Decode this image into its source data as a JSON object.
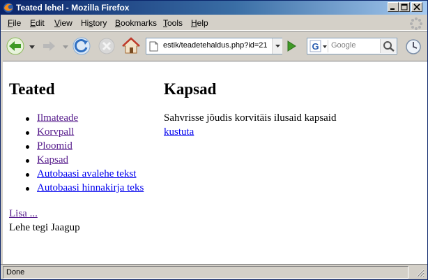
{
  "window": {
    "title": "Teated lehel - Mozilla Firefox"
  },
  "menu": [
    {
      "label": "File",
      "accel": "F"
    },
    {
      "label": "Edit",
      "accel": "E"
    },
    {
      "label": "View",
      "accel": "V"
    },
    {
      "label": "History",
      "accel": "s"
    },
    {
      "label": "Bookmarks",
      "accel": "B"
    },
    {
      "label": "Tools",
      "accel": "T"
    },
    {
      "label": "Help",
      "accel": "H"
    }
  ],
  "toolbar": {
    "url": "estik/teadetehaldus.php?id=21",
    "search_placeholder": "Google",
    "icons": [
      "back-icon",
      "forward-icon",
      "reload-icon",
      "stop-icon",
      "home-icon",
      "go-icon",
      "google-icon",
      "search-icon",
      "clock-icon"
    ]
  },
  "page": {
    "left_heading": "Teated",
    "news_items": [
      {
        "label": "Ilmateade",
        "visited": true
      },
      {
        "label": "Korvpall",
        "visited": true
      },
      {
        "label": "Ploomid",
        "visited": true
      },
      {
        "label": "Kapsad",
        "visited": true
      },
      {
        "label": "Autobaasi avalehe tekst",
        "visited": false
      },
      {
        "label": "Autobaasi hinnakirja teks",
        "visited": false
      }
    ],
    "add_link": "Lisa ...",
    "author": "Lehe tegi Jaagup",
    "article_title": "Kapsad",
    "article_body": "Sahvrisse jõudis korvitäis ilusaid kapsaid",
    "delete_link": "kustuta"
  },
  "status": {
    "text": "Done"
  },
  "colors": {
    "link": "#0000ee",
    "visited": "#551a8b",
    "titlebar_start": "#0a246a",
    "titlebar_end": "#a6caf0"
  }
}
